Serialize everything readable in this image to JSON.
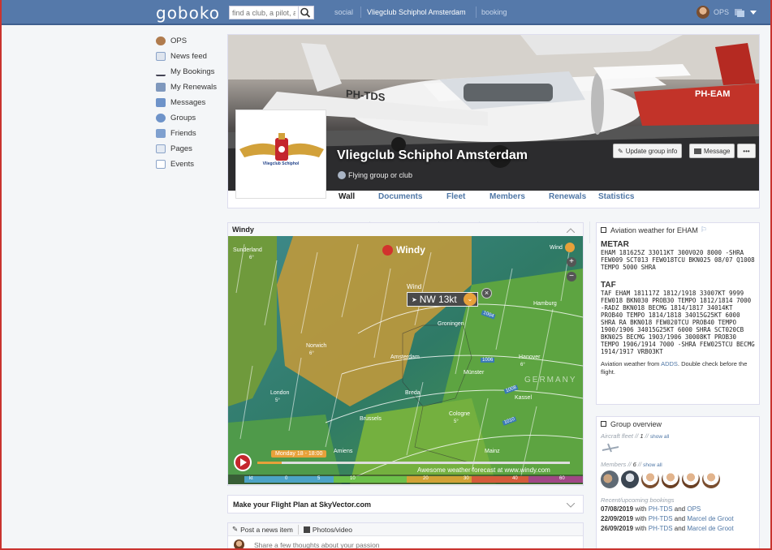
{
  "topbar": {
    "logo": "goboko",
    "search_placeholder": "find a club, a pilot, a",
    "nav": [
      "social",
      "Vliegclub Schiphol Amsterdam",
      "booking"
    ],
    "user": "OPS",
    "accent": "#5579aa"
  },
  "sidebar": {
    "items": [
      {
        "label": "OPS",
        "icon": "user-icon"
      },
      {
        "label": "News feed",
        "icon": "newspaper-icon"
      },
      {
        "label": "My Bookings",
        "icon": "airplane-icon"
      },
      {
        "label": "My Renewals",
        "icon": "calendar-icon"
      },
      {
        "label": "Messages",
        "icon": "chat-icon"
      },
      {
        "label": "Groups",
        "icon": "groups-icon"
      },
      {
        "label": "Friends",
        "icon": "friends-icon"
      },
      {
        "label": "Pages",
        "icon": "pages-icon"
      },
      {
        "label": "Events",
        "icon": "events-icon"
      }
    ]
  },
  "group": {
    "name": "Vliegclub Schiphol Amsterdam",
    "type": "Flying group or club",
    "logo_text": "Vliegclub Schiphol",
    "aircraft_reg_1": "PH-TDS",
    "aircraft_reg_2": "PH-EAM",
    "buttons": {
      "update": "Update group info",
      "message": "Message",
      "more": "•••"
    },
    "tabs": [
      "Wall",
      "Documents",
      "Fleet",
      "Members",
      "Renewals",
      "Statistics"
    ]
  },
  "windy": {
    "title": "Windy",
    "brand": "Windy",
    "wind_label": "Wind",
    "wind_reading": "NW 13kt",
    "time": "Monday 18 - 18:00",
    "footer": "Awesome weather forecast at www.windy.com",
    "places": [
      "Sunderland",
      "Norwich",
      "London",
      "Amsterdam",
      "Groningen",
      "Hamburg",
      "Hanover",
      "Brussels",
      "Cologne",
      "Kassel",
      "Münster",
      "Mainz",
      "Breda",
      "GERMANY",
      "Amiens"
    ],
    "isobars": [
      "1004",
      "1006",
      "1008",
      "1010"
    ],
    "temps": [
      "6°",
      "6°",
      "5°",
      "6°",
      "5°"
    ],
    "scale": [
      "kt",
      "0",
      "5",
      "10",
      "20",
      "30",
      "40",
      "60"
    ]
  },
  "skyvector": {
    "title": "Make your Flight Plan at SkyVector.com"
  },
  "post": {
    "tab1": "Post a news item",
    "tab2": "Photos/video",
    "placeholder": "Share a few thoughts about your passion"
  },
  "weather": {
    "title": "Aviation weather for EHAM",
    "metar_head": "METAR",
    "metar": "EHAM 181625Z 33011KT 300V020 8000 -SHRA FEW009 SCT013 FEW018TCU BKN025 08/07 Q1008 TEMPO 5000 SHRA",
    "taf_head": "TAF",
    "taf": "TAF EHAM 181117Z 1812/1918 33007KT 9999 FEW018 BKN030 PROB30 TEMPO 1812/1814 7000 -RADZ BKN018 BECMG 1814/1817 34014KT PROB40 TEMPO 1814/1818 34015G25KT 6000 SHRA RA BKN018 FEW020TCU PROB40 TEMPO 1900/1906 34015G25KT 6000 SHRA SCT020CB BKN025 BECMG 1903/1906 30008KT PROB30 TEMPO 1906/1914 7000 -SHRA FEW025TCU BECMG 1914/1917 VRB03KT",
    "note_pre": "Aviation weather from ",
    "note_link": "ADDS",
    "note_post": ". Double check before the flight."
  },
  "overview": {
    "title": "Group overview",
    "fleet_label": "Aircraft fleet",
    "fleet_count": "1",
    "members_label": "Members",
    "members_count": "6",
    "show_all": "show all",
    "bookings_label": "Recent/upcoming bookings",
    "bookings": [
      {
        "date": "07/08/2019",
        "with": "with",
        "reg": "PH-TDS",
        "and": "and",
        "person": "OPS"
      },
      {
        "date": "22/09/2019",
        "with": "with",
        "reg": "PH-TDS",
        "and": "and",
        "person": "Marcel de Groot"
      },
      {
        "date": "26/09/2019",
        "with": "with",
        "reg": "PH-TDS",
        "and": "and",
        "person": "Marcel de Groot"
      }
    ]
  }
}
